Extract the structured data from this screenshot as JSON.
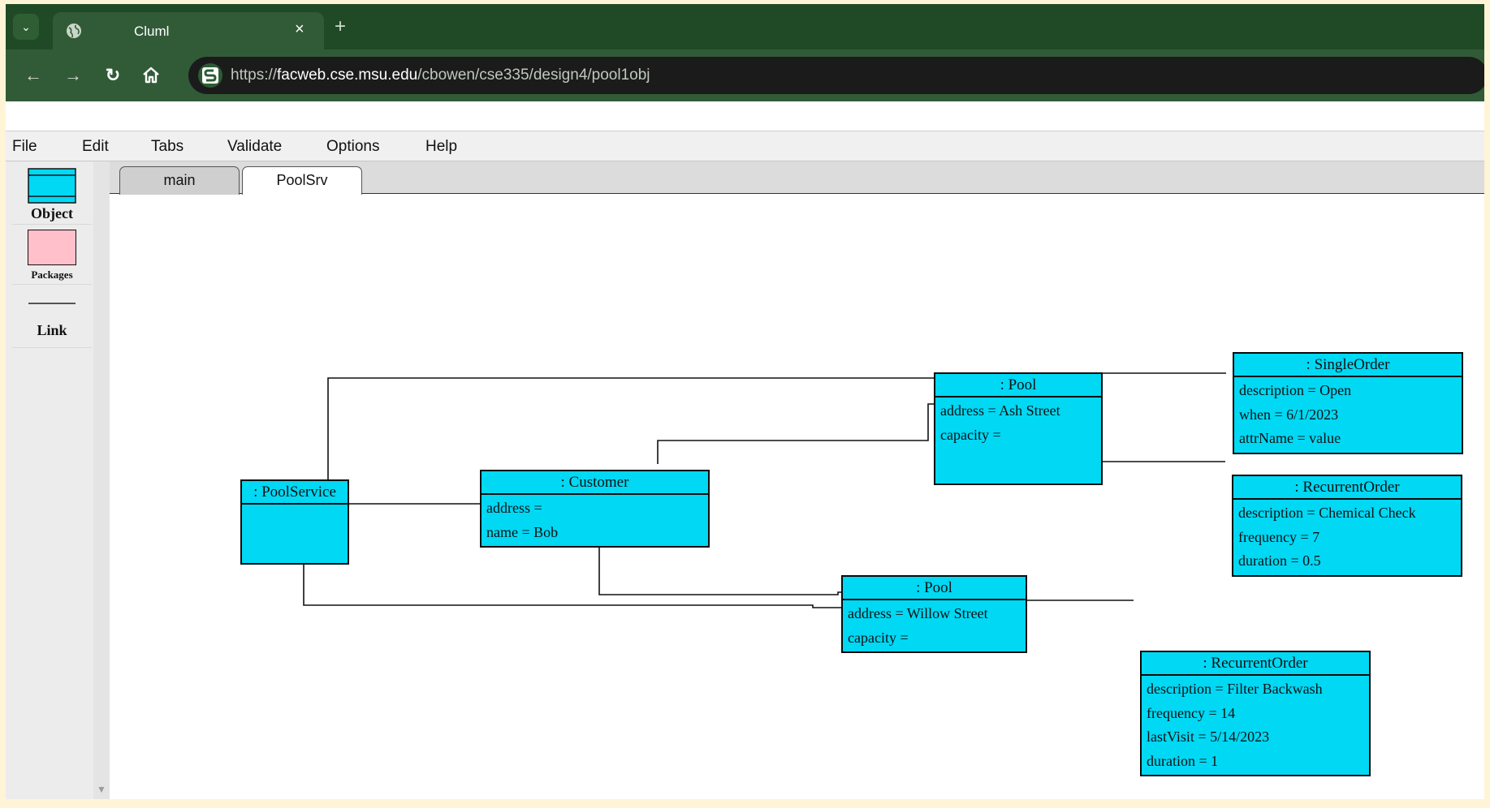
{
  "browser": {
    "tab_title": "Cluml",
    "tab_close": "×",
    "new_tab": "+",
    "url_prefix": "https://",
    "url_host": "facweb.cse.msu.edu",
    "url_path": "/cbowen/cse335/design4/pool1obj"
  },
  "menu": {
    "file": "File",
    "edit": "Edit",
    "tabs": "Tabs",
    "validate": "Validate",
    "options": "Options",
    "help": "Help"
  },
  "palette": {
    "object": "Object",
    "packages": "Packages",
    "link": "Link"
  },
  "tabs": {
    "main": "main",
    "poolsrv": "PoolSrv"
  },
  "objects": {
    "poolservice": {
      "title": ": PoolService"
    },
    "customer": {
      "title": ": Customer",
      "attrs": [
        "address =",
        "name = Bob"
      ]
    },
    "pool1": {
      "title": ": Pool",
      "attrs": [
        "address = Ash Street",
        "capacity ="
      ]
    },
    "pool2": {
      "title": ": Pool",
      "attrs": [
        "address = Willow Street",
        "capacity ="
      ]
    },
    "singleorder": {
      "title": ": SingleOrder",
      "attrs": [
        "description = Open",
        "when = 6/1/2023",
        "attrName = value"
      ]
    },
    "recurrent1": {
      "title": ": RecurrentOrder",
      "attrs": [
        "description = Chemical Check",
        "frequency = 7",
        "duration = 0.5"
      ]
    },
    "recurrent2": {
      "title": ": RecurrentOrder",
      "attrs": [
        "description = Filter Backwash",
        "frequency = 14",
        "lastVisit = 5/14/2023",
        "duration = 1"
      ]
    }
  },
  "colors": {
    "object_fill": "#00d8f4",
    "package_fill": "#ffc0cb",
    "chrome_dark": "#1f4a25",
    "chrome": "#315b37"
  }
}
